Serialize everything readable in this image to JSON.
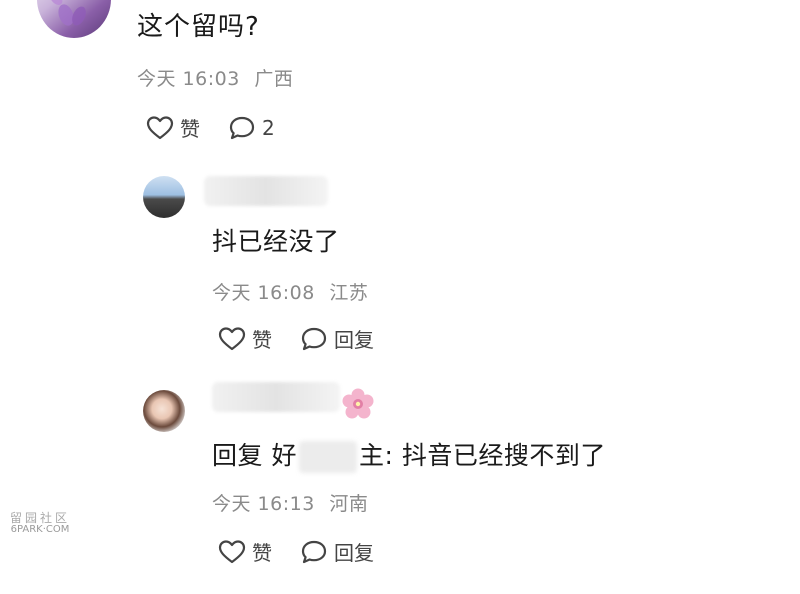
{
  "comment": {
    "text": "这个留吗?",
    "time": "今天 16:03",
    "location": "广西",
    "like_label": "赞",
    "reply_count": "2"
  },
  "replies": [
    {
      "text": "抖已经没了",
      "time": "今天 16:08",
      "location": "江苏",
      "like_label": "赞",
      "reply_label": "回复"
    },
    {
      "text_prefix": "回复 ",
      "text_partial_1": "好",
      "text_partial_2": "主",
      "text_suffix": ": 抖音已经搜不到了",
      "time": "今天 16:13",
      "location": "河南",
      "like_label": "赞",
      "reply_label": "回复"
    }
  ],
  "watermark": {
    "line1": "留园社区",
    "line2": "6PARK·COM"
  },
  "colors": {
    "meta_gray": "#8a8a8a",
    "text_dark": "#1a1a1a",
    "icon_gray": "#444444",
    "flower_pink": "#f2a6c4"
  },
  "icons": [
    "heart-icon",
    "comment-bubble-icon",
    "flower-emoji-icon"
  ]
}
